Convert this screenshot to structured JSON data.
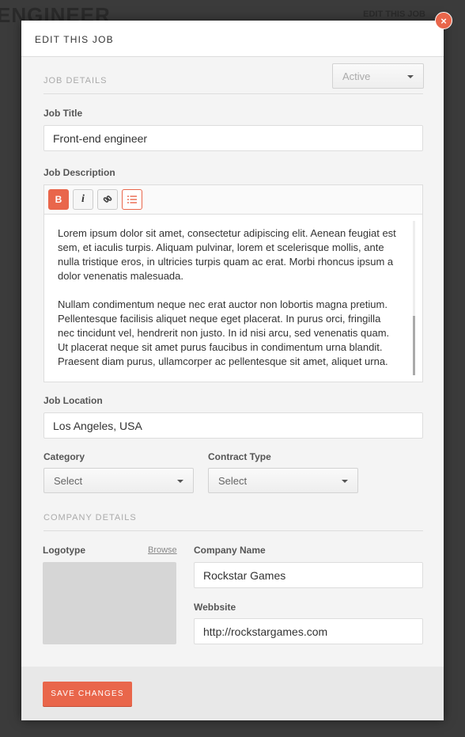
{
  "background": {
    "title": "ENGINEER",
    "link": "EDIT THIS JOB"
  },
  "modal": {
    "title": "EDIT THIS JOB",
    "close_icon": "close-icon"
  },
  "job_details": {
    "section": "JOB DETAILS",
    "status": "Active",
    "title_label": "Job Title",
    "title_value": "Front-end engineer",
    "description_label": "Job Description",
    "toolbar": {
      "bold": "B",
      "italic": "i"
    },
    "description": [
      "Lorem ipsum dolor sit amet, consectetur adipiscing elit. Aenean feugiat est sem, et iaculis turpis. Aliquam pulvinar, lorem et scelerisque mollis, ante nulla tristique eros, in ultricies turpis quam ac erat. Morbi rhoncus ipsum a dolor venenatis malesuada.",
      "Nullam condimentum neque nec erat auctor non lobortis magna pretium. Pellentesque facilisis aliquet neque eget placerat. In purus orci, fringilla nec tincidunt vel, hendrerit non justo. In id nisi arcu, sed venenatis quam. Ut placerat neque sit amet purus faucibus in condimentum urna blandit. Praesent diam purus, ullamcorper ac pellentesque sit amet, aliquet urna."
    ],
    "location_label": "Job Location",
    "location_value": "Los Angeles, USA",
    "category_label": "Category",
    "category_value": "Select",
    "contract_label": "Contract Type",
    "contract_value": "Select"
  },
  "company_details": {
    "section": "COMPANY DETAILS",
    "logotype_label": "Logotype",
    "browse": "Browse",
    "name_label": "Company Name",
    "name_value": "Rockstar Games",
    "website_label": "Webbsite",
    "website_value": "http://rockstargames.com"
  },
  "footer": {
    "save": "SAVE CHANGES"
  },
  "colors": {
    "accent": "#e9664b"
  }
}
